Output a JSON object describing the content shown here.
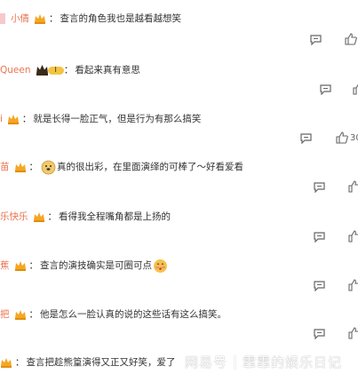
{
  "comments": [
    {
      "username": "小倩",
      "colon": "：",
      "text": "查言的角色我也是越看越想笑",
      "has_pink_block": true
    },
    {
      "username": "Queen",
      "colon": "：",
      "text": "看起来真有意思",
      "badge_text": "I"
    },
    {
      "username": "i",
      "colon": "：",
      "text": "就是长得一脸正气，但是行为有那么搞笑",
      "like_count": "30"
    },
    {
      "username": "苗",
      "colon": "：",
      "text_after_emoji": "真的很出彩，在里面演绎的可棒了～好看爱看"
    },
    {
      "username": "乐快乐",
      "colon": "：",
      "text": "看得我全程嘴角都是上扬的"
    },
    {
      "username": "蕉",
      "colon": "：",
      "text": "查言的演技确实是可圈可点"
    },
    {
      "username": "把",
      "colon": "：",
      "text": "他是怎么一脸认真的说的这些话有这么搞笑。"
    },
    {
      "username": "",
      "colon": "：",
      "text": "查言把趁熊篁演得又正又好笑，爱了"
    }
  ],
  "watermark": {
    "brand": "网易号",
    "account": "霏霏的娱乐日记"
  },
  "colors": {
    "username": "#eb7350",
    "text": "#333333",
    "icon": "#666666",
    "crown": "#f5a623"
  }
}
